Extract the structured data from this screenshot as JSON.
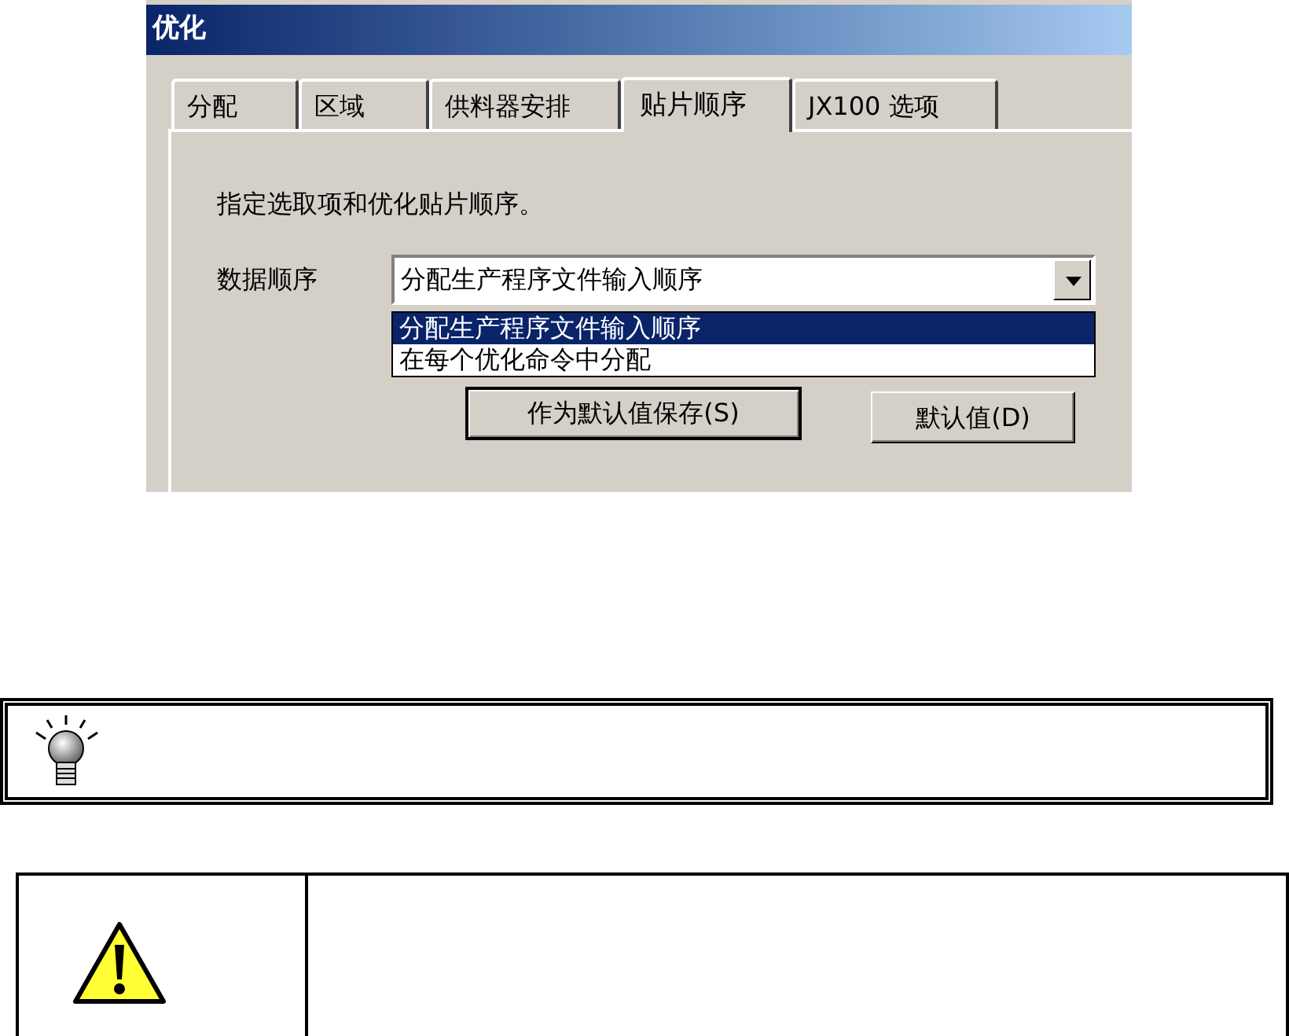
{
  "window": {
    "title": "优化"
  },
  "tabs": [
    {
      "label": "分配",
      "selected": false
    },
    {
      "label": "区域",
      "selected": false
    },
    {
      "label": "供料器安排",
      "selected": false
    },
    {
      "label": "贴片顺序",
      "selected": true
    },
    {
      "label": "JX100 选项",
      "selected": false
    }
  ],
  "description": "指定选取项和优化贴片顺序。",
  "data_order": {
    "label": "数据顺序",
    "value": "分配生产程序文件输入顺序",
    "options": [
      {
        "label": "分配生产程序文件输入顺序",
        "selected": true
      },
      {
        "label": "在每个优化命令中分配",
        "selected": false
      }
    ]
  },
  "buttons": [
    {
      "label": "作为默认值保存(S)",
      "default": true
    },
    {
      "label": "默认值(D)",
      "default": false
    }
  ]
}
